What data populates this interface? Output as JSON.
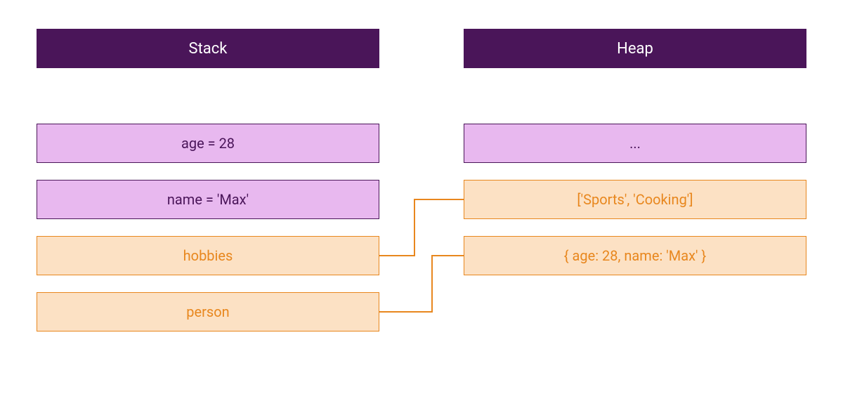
{
  "headers": {
    "stack": "Stack",
    "heap": "Heap"
  },
  "stack": {
    "row1": "age = 28",
    "row2": "name = 'Max'",
    "row3": "hobbies",
    "row4": "person"
  },
  "heap": {
    "row1": "...",
    "row2": "['Sports', 'Cooking']",
    "row3": "{ age: 28, name: 'Max' }"
  },
  "colors": {
    "headerBg": "#4a1559",
    "headerText": "#ffffff",
    "purpleBoxBg": "#e8b8ef",
    "purpleBoxBorder": "#4a1559",
    "purpleBoxText": "#4a1559",
    "orangeBoxBg": "#fce1c4",
    "orangeBoxBorder": "#e8871e",
    "orangeBoxText": "#e8871e",
    "connector": "#e8871e"
  },
  "connections": [
    {
      "from": "stack.row3",
      "to": "heap.row2",
      "desc": "hobbies -> ['Sports','Cooking']"
    },
    {
      "from": "stack.row4",
      "to": "heap.row3",
      "desc": "person -> { age: 28, name: 'Max' }"
    }
  ]
}
